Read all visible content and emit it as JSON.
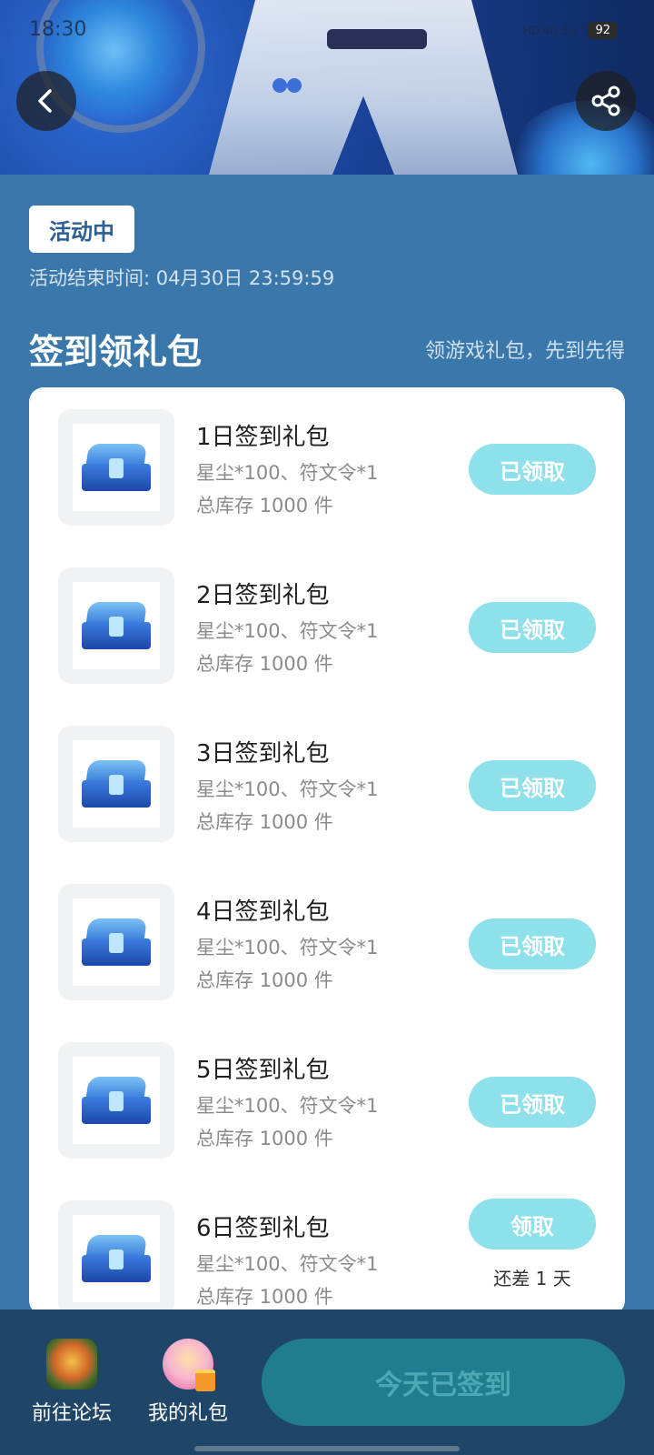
{
  "status_bar": {
    "time": "18:30",
    "network": "HD 4G 5G",
    "battery": "92"
  },
  "header": {
    "back_icon": "chevron-left-icon",
    "share_icon": "share-icon"
  },
  "activity": {
    "status_tag": "活动中",
    "end_time": "活动结束时间: 04月30日 23:59:59"
  },
  "section": {
    "title": "签到领礼包",
    "subtitle": "领游戏礼包，先到先得"
  },
  "gifts": [
    {
      "title": "1日签到礼包",
      "desc": "星尘*100、符文令*1",
      "stock": "总库存 1000 件",
      "button": "已领取",
      "note": ""
    },
    {
      "title": "2日签到礼包",
      "desc": "星尘*100、符文令*1",
      "stock": "总库存 1000 件",
      "button": "已领取",
      "note": ""
    },
    {
      "title": "3日签到礼包",
      "desc": "星尘*100、符文令*1",
      "stock": "总库存 1000 件",
      "button": "已领取",
      "note": ""
    },
    {
      "title": "4日签到礼包",
      "desc": "星尘*100、符文令*1",
      "stock": "总库存 1000 件",
      "button": "已领取",
      "note": ""
    },
    {
      "title": "5日签到礼包",
      "desc": "星尘*100、符文令*1",
      "stock": "总库存 1000 件",
      "button": "已领取",
      "note": ""
    },
    {
      "title": "6日签到礼包",
      "desc": "星尘*100、符文令*1",
      "stock": "总库存 1000 件",
      "button": "领取",
      "note": "还差 1 天"
    }
  ],
  "bottom_bar": {
    "forum_label": "前往论坛",
    "gifts_label": "我的礼包",
    "signed_label": "今天已签到"
  },
  "colors": {
    "page_bg": "#3a78ac",
    "claim_button": "#8ee0ea",
    "bottom_bar": "#1f4668",
    "signed_button": "#1f7d8e"
  }
}
